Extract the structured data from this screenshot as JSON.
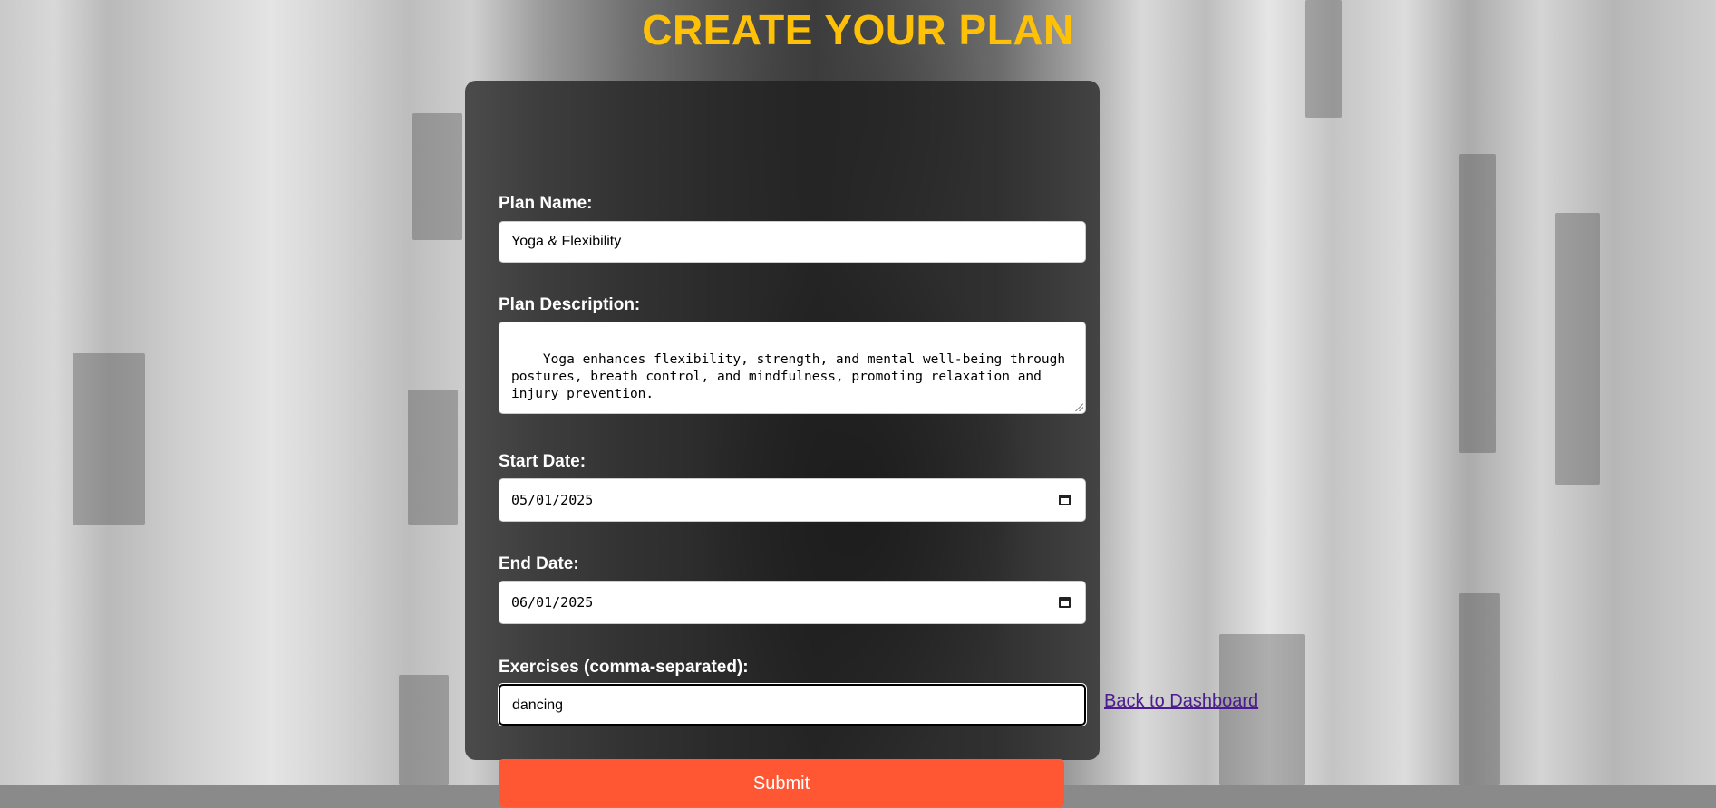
{
  "page": {
    "title": "CREATE YOUR PLAN",
    "accent_color": "#FFC107",
    "submit_color": "#FF5733"
  },
  "form": {
    "plan_name": {
      "label": "Plan Name:",
      "value": "Yoga & Flexibility"
    },
    "plan_description": {
      "label": "Plan Description:",
      "value": "Yoga enhances flexibility, strength, and mental well-being through\npostures, breath control, and mindfulness, promoting relaxation and\ninjury prevention."
    },
    "start_date": {
      "label": "Start Date:",
      "value": "05/01/2025",
      "icon": "calendar-icon"
    },
    "end_date": {
      "label": "End Date:",
      "value": "06/01/2025",
      "icon": "calendar-icon"
    },
    "exercises": {
      "label": "Exercises (comma-separated):",
      "value": "dancing"
    },
    "submit_label": "Submit"
  },
  "back_link": "Back to Dashboard"
}
